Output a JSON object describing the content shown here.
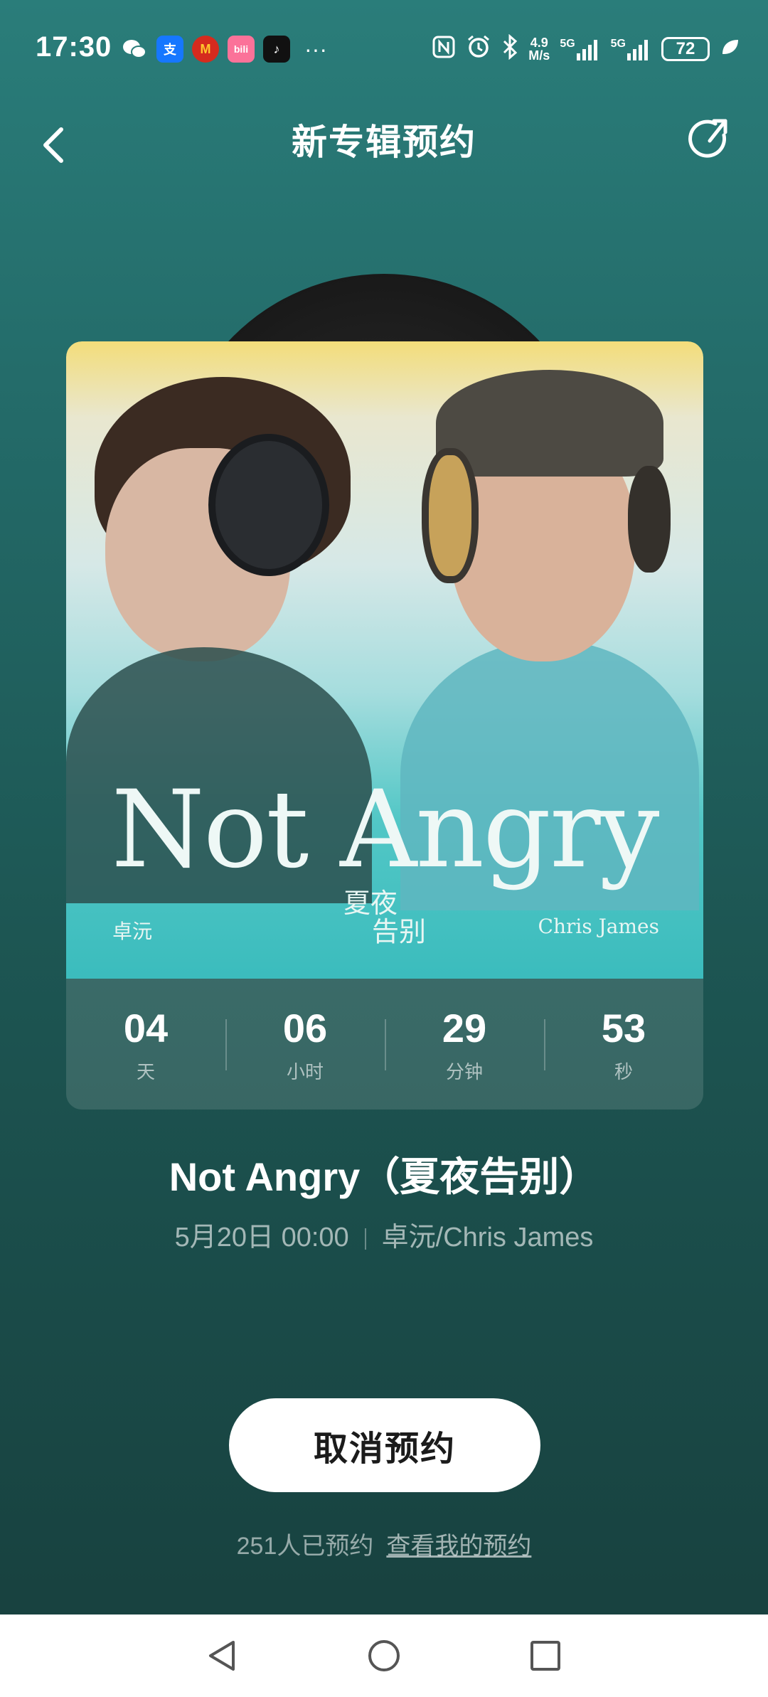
{
  "status_bar": {
    "time": "17:30",
    "app_icons": [
      {
        "name": "wechat-icon",
        "glyph": "",
        "color": "#ffffff"
      },
      {
        "name": "alipay-icon",
        "glyph": "支",
        "color": "#1677ff"
      },
      {
        "name": "mcdonalds-icon",
        "glyph": "M",
        "color": "#d52b1e"
      },
      {
        "name": "bilibili-icon",
        "glyph": "bili",
        "color": "#fb7299"
      },
      {
        "name": "tiktok-icon",
        "glyph": "♪",
        "color": "#111111"
      }
    ],
    "more": "···",
    "net_speed": "4.9\nM/s",
    "signal_1": "5G",
    "signal_2": "5G",
    "battery": "72"
  },
  "header": {
    "title": "新专辑预约",
    "back_icon": "chevron-left-icon",
    "share_icon": "share-icon"
  },
  "cover": {
    "title": "Not Angry",
    "subtitle_line1": "夏夜",
    "subtitle_line2": "告别",
    "artist_left": "卓沅",
    "artist_right": "Chris James"
  },
  "countdown": [
    {
      "value": "04",
      "unit": "天"
    },
    {
      "value": "06",
      "unit": "小时"
    },
    {
      "value": "29",
      "unit": "分钟"
    },
    {
      "value": "53",
      "unit": "秒"
    }
  ],
  "album": {
    "name": "Not Angry（夏夜告别）",
    "release": "5月20日 00:00",
    "artists": "卓沅/Chris James"
  },
  "action": {
    "cancel_label": "取消预约",
    "reserved_count": "251人已预约",
    "view_link": "查看我的预约"
  },
  "nav": [
    "back-nav-icon",
    "home-nav-icon",
    "recents-nav-icon"
  ]
}
